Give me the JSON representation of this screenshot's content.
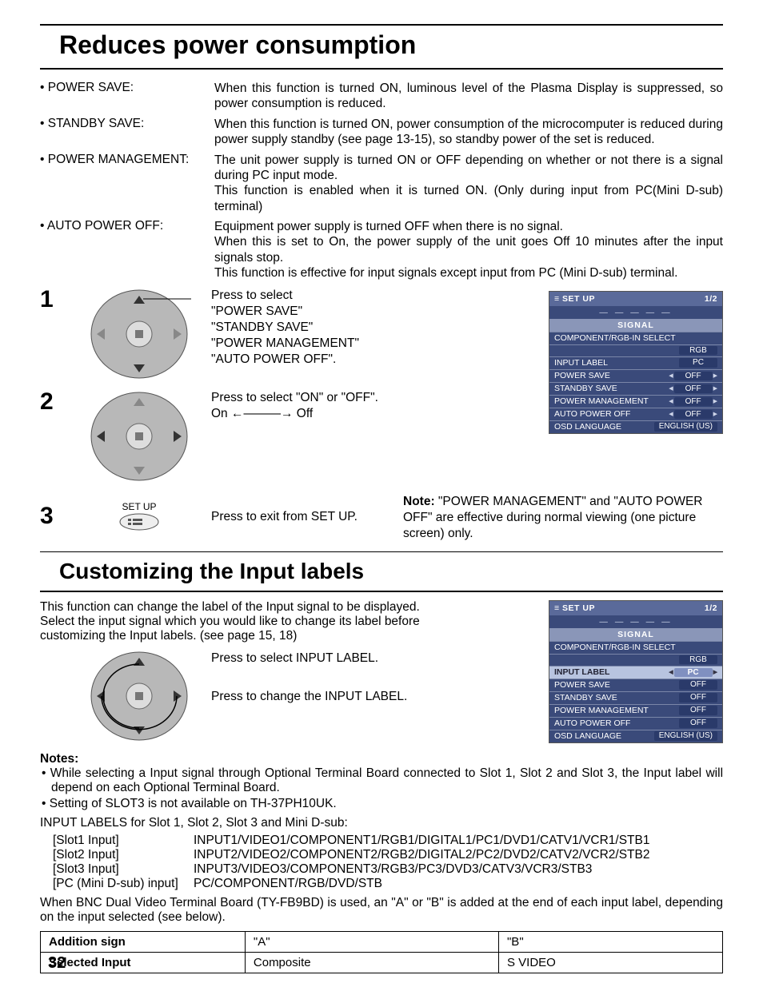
{
  "page_number": "32",
  "title1": "Reduces power consumption",
  "features": [
    {
      "label": "• POWER SAVE:",
      "desc": "When this function is turned ON, luminous level of the Plasma Display is suppressed, so power consumption is reduced."
    },
    {
      "label": "• STANDBY SAVE:",
      "desc": "When this function is turned ON, power consumption of the microcomputer is reduced during power supply standby (see page 13-15), so standby power of the set is reduced."
    },
    {
      "label": "• POWER MANAGEMENT:",
      "desc": "The unit power supply is turned ON or OFF depending on whether or not there is a signal during PC input mode.\nThis function is enabled when it is turned ON. (Only during input from PC(Mini D-sub) terminal)"
    },
    {
      "label": "• AUTO POWER OFF:",
      "desc": "Equipment power supply is turned OFF when there is no signal.\nWhen this is set to On, the power supply of the unit goes Off 10 minutes after the input signals stop.\nThis function is effective for input signals except input from PC (Mini D-sub) terminal."
    }
  ],
  "step1_lines": [
    "Press to select",
    "\"POWER SAVE\"",
    "\"STANDBY SAVE\"",
    "\"POWER MANAGEMENT\"",
    "\"AUTO POWER OFF\"."
  ],
  "step2_line1": "Press to select \"ON\" or \"OFF\".",
  "step2_line2": "On ←———→ Off",
  "step3_btn": "SET UP",
  "step3_text": "Press to exit from SET UP.",
  "note_title": "Note:",
  "note_body": "\"POWER MANAGEMENT\" and \"AUTO POWER OFF\" are effective during normal viewing (one picture screen) only.",
  "title2": "Customizing the Input labels",
  "intro2": "This function can change the label of the Input signal to be displayed.\nSelect the input signal which you would like to change its label before customizing the Input labels. (see page 15, 18)",
  "step2a": "Press to select INPUT LABEL.",
  "step2b": "Press to change the INPUT LABEL.",
  "notes_heading": "Notes:",
  "notes_list": [
    "While selecting a Input signal through Optional Terminal Board connected to Slot 1, Slot 2 and Slot 3, the Input label will depend on each Optional Terminal Board.",
    "Setting of SLOT3 is not available on TH-37PH10UK."
  ],
  "labels_heading": "INPUT LABELS for Slot 1, Slot 2, Slot 3 and Mini D-sub:",
  "labels_rows": [
    {
      "c1": "[Slot1 Input]",
      "c2": "INPUT1/VIDEO1/COMPONENT1/RGB1/DIGITAL1/PC1/DVD1/CATV1/VCR1/STB1"
    },
    {
      "c1": "[Slot2 Input]",
      "c2": "INPUT2/VIDEO2/COMPONENT2/RGB2/DIGITAL2/PC2/DVD2/CATV2/VCR2/STB2"
    },
    {
      "c1": "[Slot3 Input]",
      "c2": "INPUT3/VIDEO3/COMPONENT3/RGB3/PC3/DVD3/CATV3/VCR3/STB3"
    },
    {
      "c1": "[PC (Mini D-sub) input]",
      "c2": "PC/COMPONENT/RGB/DVD/STB"
    }
  ],
  "bnc_note": "When BNC Dual Video Terminal Board (TY-FB9BD) is used, an \"A\" or \"B\" is added at the end of each input label, depending on the input selected (see below).",
  "table": {
    "r1c1": "Addition sign",
    "r1c2": "\"A\"",
    "r1c3": "\"B\"",
    "r2c1": "Selected Input",
    "r2c2": "Composite",
    "r2c3": "S VIDEO"
  },
  "osd": {
    "title": "SET UP",
    "page": "1/2",
    "signal": "SIGNAL",
    "comp": "COMPONENT/RGB-IN SELECT",
    "comp_val": "RGB",
    "input_label": "INPUT LABEL",
    "input_label_val": "PC",
    "power_save": "POWER SAVE",
    "power_save_val": "OFF",
    "standby": "STANDBY SAVE",
    "standby_val": "OFF",
    "pm": "POWER MANAGEMENT",
    "pm_val": "OFF",
    "apo": "AUTO POWER OFF",
    "apo_val": "OFF",
    "lang": "OSD LANGUAGE",
    "lang_val": "ENGLISH (US)"
  }
}
